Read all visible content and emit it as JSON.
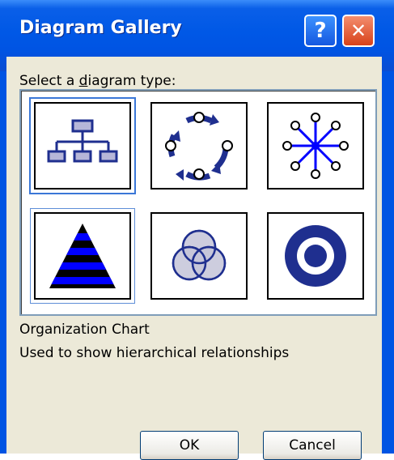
{
  "window": {
    "title": "Diagram Gallery"
  },
  "titlebar_buttons": {
    "help_symbol": "?",
    "close_symbol": "✕"
  },
  "prompt": {
    "before": "Select a ",
    "accel": "d",
    "after": "iagram type:"
  },
  "diagram_types": [
    {
      "name": "Organization Chart",
      "icon": "org-chart-icon",
      "selected": true
    },
    {
      "name": "Cycle",
      "icon": "cycle-diagram-icon",
      "selected": false
    },
    {
      "name": "Radial",
      "icon": "radial-diagram-icon",
      "selected": false
    },
    {
      "name": "Pyramid",
      "icon": "pyramid-diagram-icon",
      "selected": false
    },
    {
      "name": "Venn",
      "icon": "venn-diagram-icon",
      "selected": false
    },
    {
      "name": "Target",
      "icon": "target-diagram-icon",
      "selected": false
    }
  ],
  "description": {
    "name": "Organization Chart",
    "text": "Used to show hierarchical relationships"
  },
  "buttons": {
    "ok": "OK",
    "cancel": "Cancel"
  },
  "colors": {
    "titlebar": "#0054e3",
    "client": "#ece9d8",
    "diagram_navy": "#1f2f8f",
    "accent_blue": "#0000ff"
  }
}
